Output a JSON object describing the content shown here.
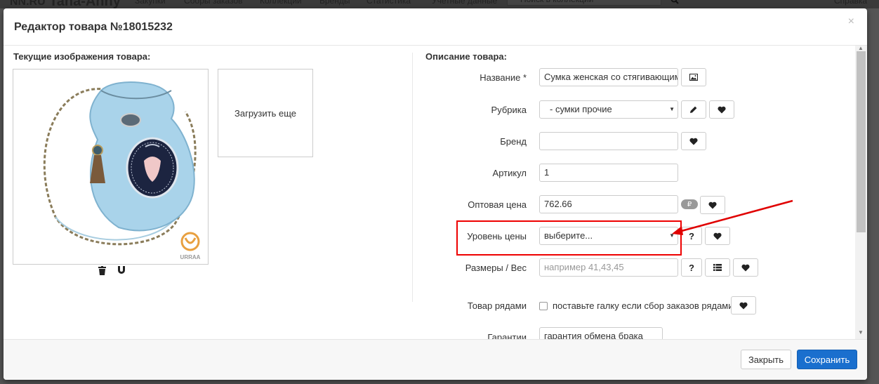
{
  "background": {
    "logo": "NN.RU",
    "brand": "Tana-Anny",
    "tabs": [
      "Закупки",
      "Сборы заказов",
      "Коллекции",
      "Бренды",
      "Статистика",
      "Учетные данные"
    ],
    "search_placeholder": "Поиск в коллекции",
    "help": "Справка"
  },
  "modal": {
    "title": "Редактор товара №18015232",
    "close": "×"
  },
  "images_section": {
    "label": "Текущие изображения товара:",
    "upload_label": "Загрузить еще",
    "watermark": "URRAA"
  },
  "description_section": {
    "label": "Описание товара:",
    "fields": {
      "name": {
        "label": "Название *",
        "value": "Сумка женская со стягивающим"
      },
      "rubric": {
        "label": "Рубрика",
        "value": "-  сумки прочие"
      },
      "brand": {
        "label": "Бренд",
        "value": ""
      },
      "article": {
        "label": "Артикул",
        "value": "1"
      },
      "wholesale_price": {
        "label": "Оптовая цена",
        "value": "762.66",
        "badge": "₽"
      },
      "price_level": {
        "label": "Уровень цены",
        "value": "выберите..."
      },
      "sizes": {
        "label": "Размеры / Вес",
        "placeholder": "например 41,43,45"
      },
      "rows": {
        "label": "Товар рядами",
        "checkbox_label": "поставьте галку если сбор заказов рядами"
      },
      "guarantee": {
        "label": "Гарантии",
        "value": "гарантия обмена брака"
      }
    },
    "question_mark": "?"
  },
  "footer": {
    "close_label": "Закрыть",
    "save_label": "Сохранить"
  },
  "colors": {
    "primary": "#1a6fce",
    "highlight": "#e00000"
  }
}
